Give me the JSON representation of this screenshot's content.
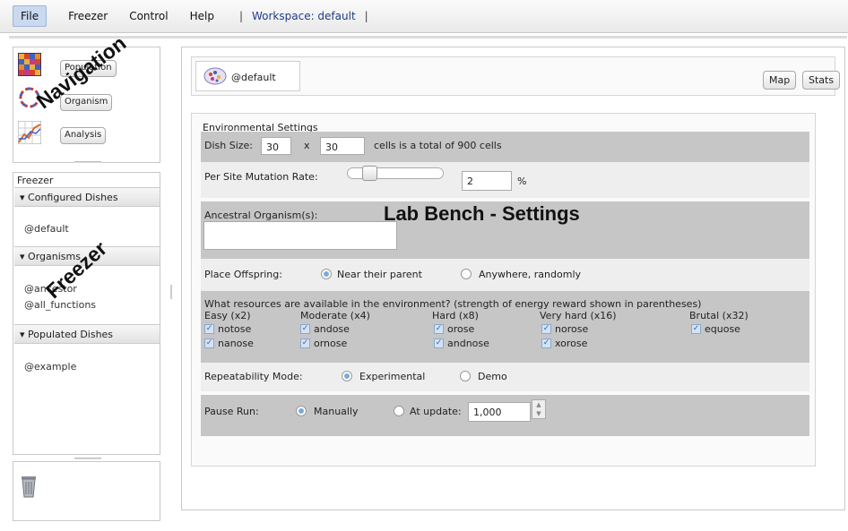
{
  "menu": {
    "file": "File",
    "freezer": "Freezer",
    "control": "Control",
    "help": "Help",
    "sep": "|",
    "workspace": "Workspace: default"
  },
  "navigation": {
    "population": "Population",
    "organism": "Organism",
    "analysis": "Analysis",
    "overlay": "Navigation"
  },
  "freezer": {
    "title": "Freezer",
    "overlay": "Freezer",
    "configured_header": "Configured Dishes",
    "configured_items": [
      "@default"
    ],
    "organisms_header": "Organisms",
    "organism_items": [
      "@ancestor",
      "@all_functions"
    ],
    "populated_header": "Populated Dishes",
    "populated_items": [
      "@example"
    ]
  },
  "main": {
    "dish_name": "@default",
    "map_label": "Map",
    "stats_label": "Stats",
    "overlay": "Lab Bench - Settings"
  },
  "settings": {
    "title": "Environmental Settings",
    "dish_size_label": "Dish Size:",
    "dish_w": "30",
    "times": "x",
    "dish_h": "30",
    "dish_total": "cells is a total of 900 cells",
    "mutation_label": "Per Site Mutation Rate:",
    "mutation_value": "2",
    "mutation_unit": "%",
    "ancestral_label": "Ancestral Organism(s):",
    "ancestral_value": "",
    "offspring_label": "Place Offspring:",
    "offspring_near": "Near their parent",
    "offspring_anywhere": "Anywhere, randomly",
    "offspring_selected": "near",
    "resources_question": "What resources are available in the environment? (strength of energy reward shown in parentheses)",
    "resources": [
      {
        "level": "Easy (x2)",
        "items": [
          "notose",
          "nanose"
        ]
      },
      {
        "level": "Moderate (x4)",
        "items": [
          "andose",
          "ornose"
        ]
      },
      {
        "level": "Hard (x8)",
        "items": [
          "orose",
          "andnose"
        ]
      },
      {
        "level": "Very hard (x16)",
        "items": [
          "norose",
          "xorose"
        ]
      },
      {
        "level": "Brutal (x32)",
        "items": [
          "equose"
        ]
      }
    ],
    "repeat_label": "Repeatability Mode:",
    "repeat_experimental": "Experimental",
    "repeat_demo": "Demo",
    "repeat_selected": "experimental",
    "pause_label": "Pause Run:",
    "pause_manually": "Manually",
    "pause_at_update": "At update:",
    "pause_update_value": "1,000",
    "pause_selected": "manually"
  },
  "colors": {
    "accent": "#7ea9d8",
    "panel_grey": "#c6c6c6",
    "panel_light": "#eeeeee",
    "workspace_text": "#1f3d8a"
  }
}
